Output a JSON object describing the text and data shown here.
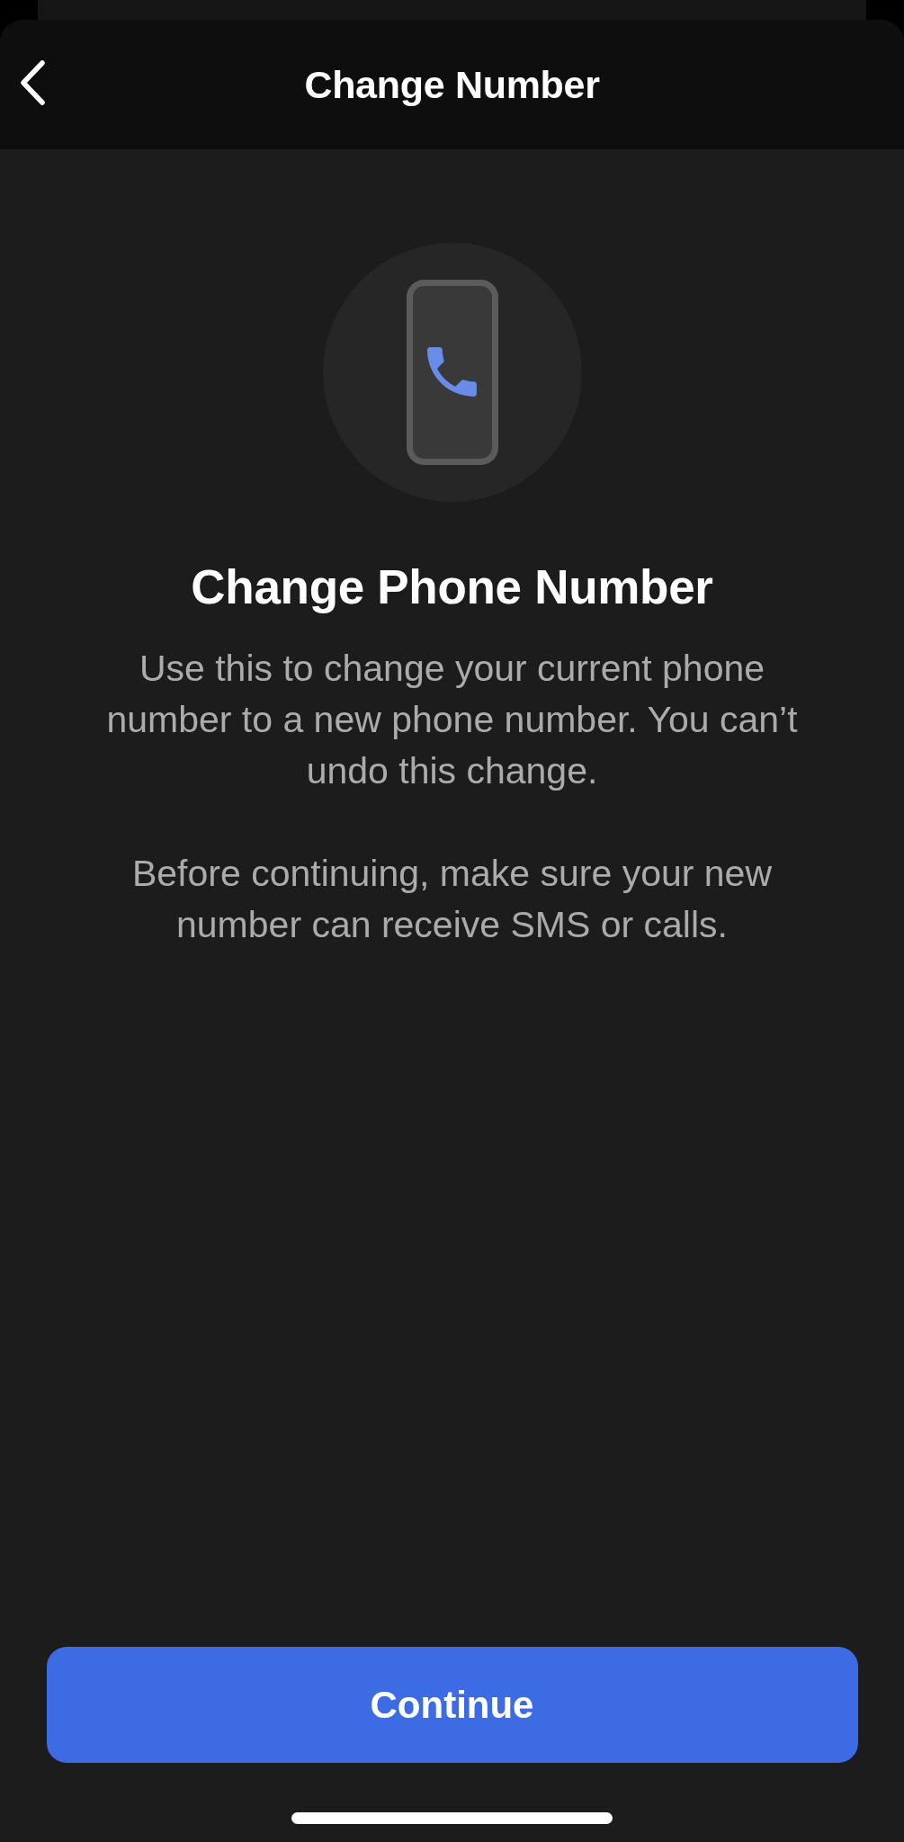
{
  "header": {
    "title": "Change Number"
  },
  "content": {
    "title": "Change Phone Number",
    "paragraphs": [
      "Use this to change your current phone number to a new phone number. You can’t undo this change.",
      "Before continuing, make sure your new number can receive SMS or calls."
    ]
  },
  "primary_button": {
    "label": "Continue"
  }
}
